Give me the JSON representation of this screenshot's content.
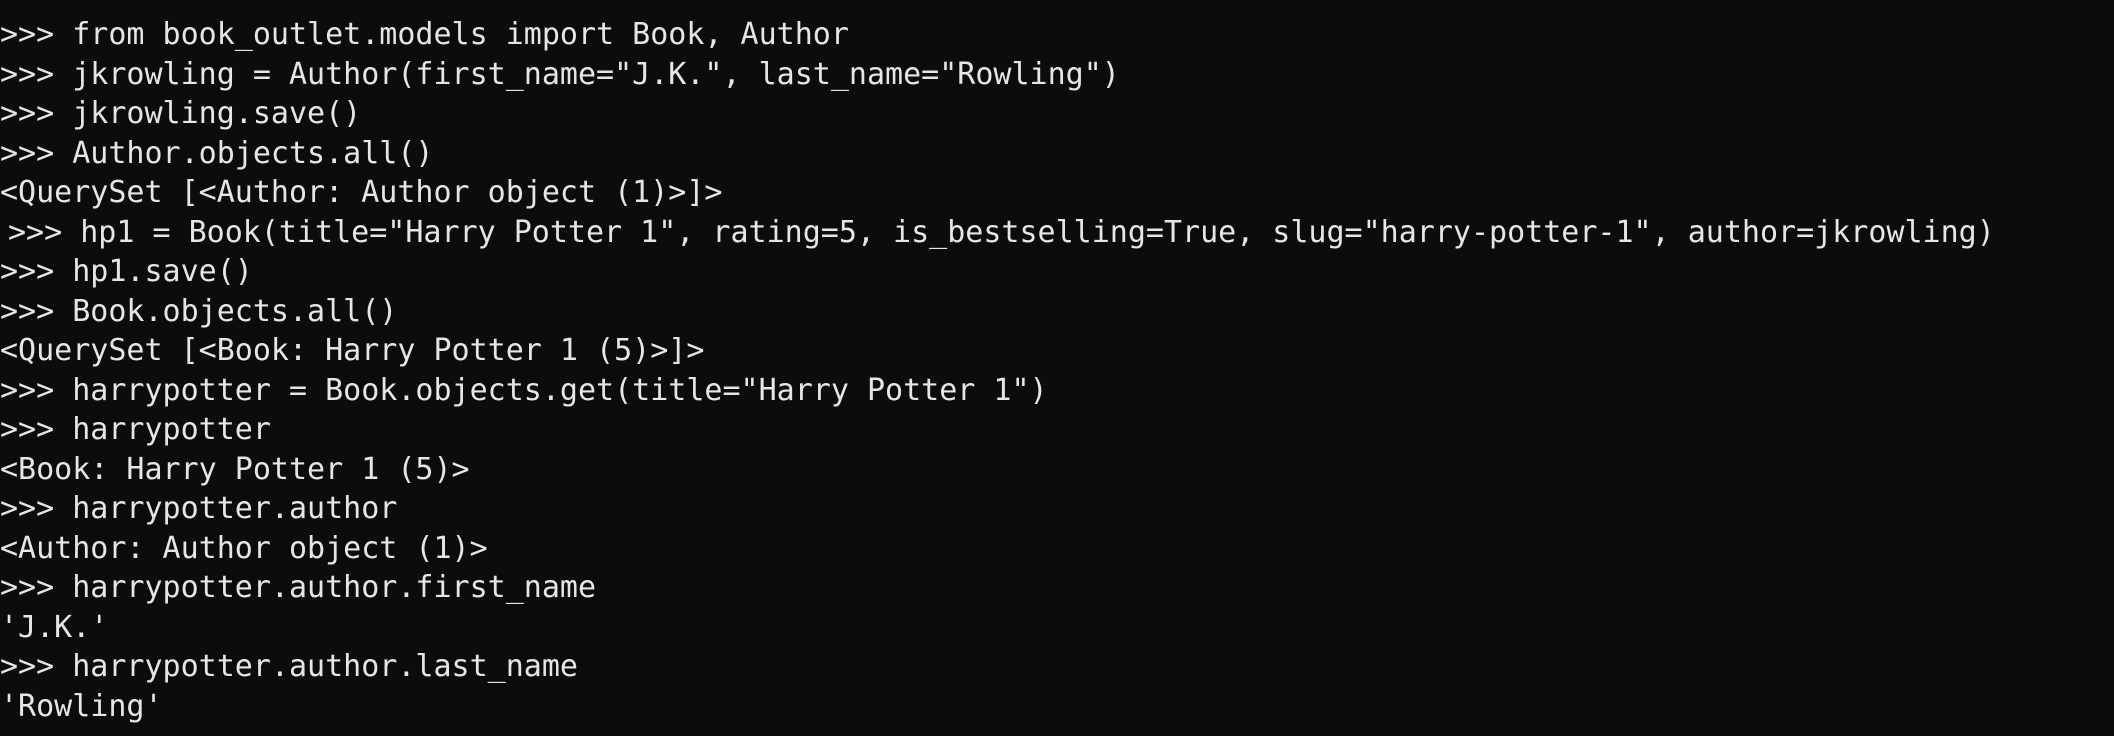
{
  "terminal": {
    "background": "#0c0c0c",
    "foreground": "#e6e6e6",
    "prompt": ">>>",
    "lines": [
      {
        "kind": "input",
        "text": "from book_outlet.models import Book, Author"
      },
      {
        "kind": "input",
        "text": "jkrowling = Author(first_name=\"J.K.\", last_name=\"Rowling\")"
      },
      {
        "kind": "input",
        "text": "jkrowling.save()"
      },
      {
        "kind": "input",
        "text": "Author.objects.all()"
      },
      {
        "kind": "output",
        "text": "<QuerySet [<Author: Author object (1)>]>"
      },
      {
        "kind": "input",
        "text": "hp1 = Book(title=\"Harry Potter 1\", rating=5, is_bestselling=True, slug=\"harry-potter-1\", author=jkrowling)"
      },
      {
        "kind": "input",
        "text": "hp1.save()"
      },
      {
        "kind": "input",
        "text": "Book.objects.all()"
      },
      {
        "kind": "output",
        "text": "<QuerySet [<Book: Harry Potter 1 (5)>]>"
      },
      {
        "kind": "input",
        "text": "harrypotter = Book.objects.get(title=\"Harry Potter 1\")"
      },
      {
        "kind": "input",
        "text": "harrypotter"
      },
      {
        "kind": "output",
        "text": "<Book: Harry Potter 1 (5)>"
      },
      {
        "kind": "input",
        "text": "harrypotter.author"
      },
      {
        "kind": "output",
        "text": "<Author: Author object (1)>"
      },
      {
        "kind": "input",
        "text": "harrypotter.author.first_name"
      },
      {
        "kind": "output",
        "text": "'J.K.'"
      },
      {
        "kind": "input",
        "text": "harrypotter.author.last_name"
      },
      {
        "kind": "output",
        "text": "'Rowling'"
      }
    ]
  }
}
